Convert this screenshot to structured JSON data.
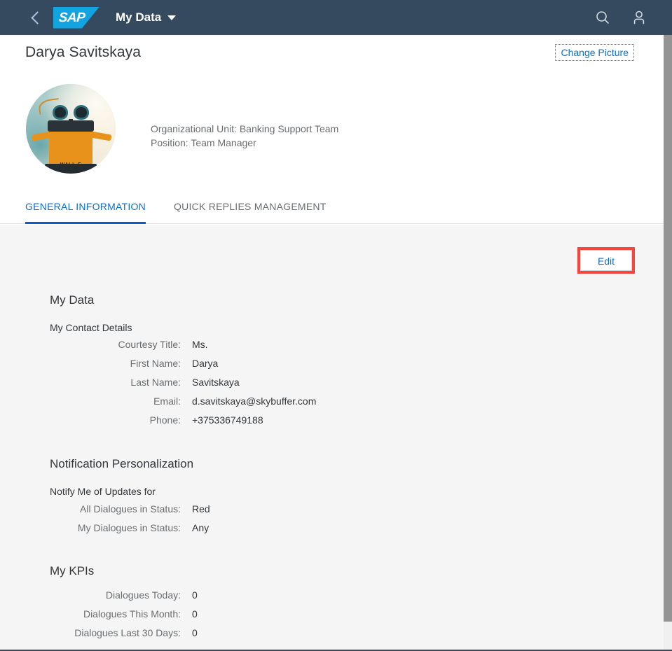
{
  "shell": {
    "back_icon": "chevron-left-icon",
    "logo_text": "SAP",
    "title": "My Data",
    "search_icon": "search-icon",
    "user_icon": "user-icon"
  },
  "object_header": {
    "title": "Darya Savitskaya",
    "change_picture_label": "Change Picture",
    "avatar_alt": "profile-photo",
    "avatar_caption": "WALL-E",
    "org_unit_line": "Organizational Unit: Banking Support Team",
    "position_line": "Position: Team Manager"
  },
  "tabs": [
    {
      "label": "GENERAL INFORMATION",
      "selected": true
    },
    {
      "label": "QUICK REPLIES MANAGEMENT",
      "selected": false
    }
  ],
  "toolbar": {
    "edit_label": "Edit"
  },
  "sections": {
    "my_data": {
      "title": "My Data",
      "group_title": "My Contact Details",
      "fields": [
        {
          "label": "Courtesy Title:",
          "value": "Ms."
        },
        {
          "label": "First Name:",
          "value": "Darya"
        },
        {
          "label": "Last Name:",
          "value": "Savitskaya"
        },
        {
          "label": "Email:",
          "value": "d.savitskaya@skybuffer.com"
        },
        {
          "label": "Phone:",
          "value": "+375336749188"
        }
      ]
    },
    "notification": {
      "title": "Notification Personalization",
      "group_title": "Notify Me of Updates for",
      "fields": [
        {
          "label": "All Dialogues in Status:",
          "value": "Red"
        },
        {
          "label": "My Dialogues in Status:",
          "value": "Any"
        }
      ]
    },
    "kpis": {
      "title": "My KPIs",
      "fields": [
        {
          "label": "Dialogues Today:",
          "value": "0"
        },
        {
          "label": "Dialogues This Month:",
          "value": "0"
        },
        {
          "label": "Dialogues Last 30 Days:",
          "value": "0"
        }
      ]
    }
  },
  "colors": {
    "shell_bg": "#354a5f",
    "logo_blue": "#12a4e0",
    "accent_blue": "#0a6ed1",
    "selected_tab_underline": "#0a5ec2",
    "highlight_red": "#f4463c",
    "content_bg": "#f5f5f5",
    "label_grey": "#6a6d70",
    "value_dark": "#32363a"
  }
}
